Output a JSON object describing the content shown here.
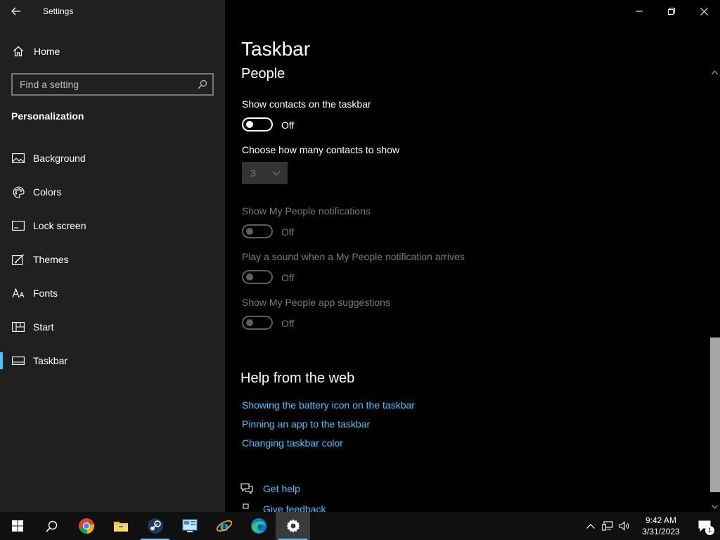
{
  "window": {
    "app_title": "Settings"
  },
  "sidebar": {
    "home_label": "Home",
    "search_placeholder": "Find a setting",
    "section_title": "Personalization",
    "items": [
      {
        "label": "Background",
        "icon": "image-icon"
      },
      {
        "label": "Colors",
        "icon": "palette-icon"
      },
      {
        "label": "Lock screen",
        "icon": "lock-screen-icon"
      },
      {
        "label": "Themes",
        "icon": "brush-icon"
      },
      {
        "label": "Fonts",
        "icon": "font-icon"
      },
      {
        "label": "Start",
        "icon": "start-icon"
      },
      {
        "label": "Taskbar",
        "icon": "taskbar-icon",
        "active": true
      }
    ]
  },
  "main": {
    "page_title": "Taskbar",
    "section": "People",
    "show_contacts": {
      "label": "Show contacts on the taskbar",
      "state": "Off"
    },
    "contacts_count": {
      "label": "Choose how many contacts to show",
      "value": "3"
    },
    "notifications": {
      "label": "Show My People notifications",
      "state": "Off"
    },
    "sound": {
      "label": "Play a sound when a My People notification arrives",
      "state": "Off"
    },
    "suggestions": {
      "label": "Show My People app suggestions",
      "state": "Off"
    },
    "help": {
      "title": "Help from the web",
      "links": [
        "Showing the battery icon on the taskbar",
        "Pinning an app to the taskbar",
        "Changing taskbar color"
      ],
      "get_help": "Get help",
      "feedback": "Give feedback"
    }
  },
  "taskbar": {
    "apps": [
      "start-icon",
      "search-icon",
      "chrome-icon",
      "file-explorer-icon",
      "steam-icon",
      "control-panel-icon",
      "internet-explorer-icon",
      "edge-icon",
      "settings-icon"
    ],
    "time": "9:42 AM",
    "date": "3/31/2023",
    "notification_count": "1"
  },
  "colors": {
    "accent": "#4cc2ff",
    "sidebar_bg": "#202020",
    "main_bg": "#000000",
    "taskbar_bg": "#101010"
  }
}
